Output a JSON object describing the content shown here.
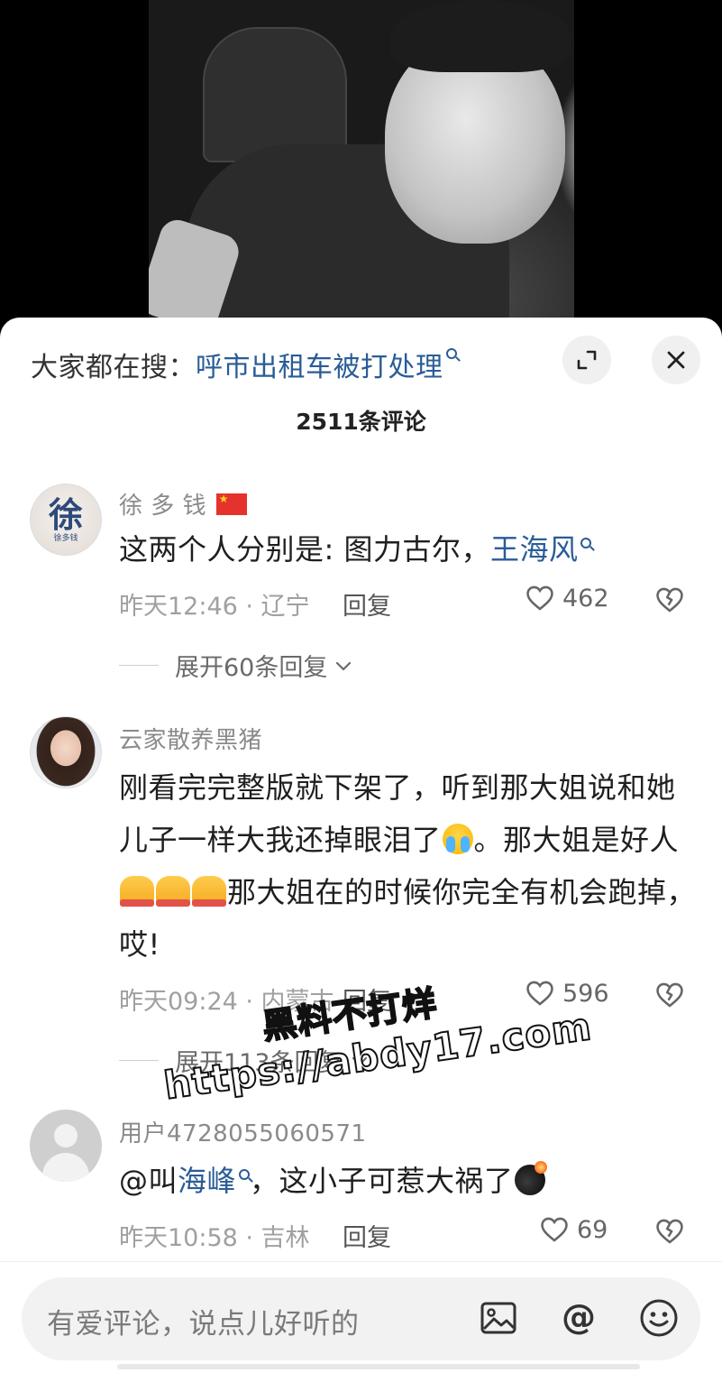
{
  "search": {
    "prefix": "大家都在搜：",
    "term": "呼市出租车被打处理"
  },
  "comments_count": "2511条评论",
  "comments": [
    {
      "username": "徐 多 钱",
      "avatar_text": "徐",
      "avatar_subtext": "徐多钱",
      "text_before_link": "这两个人分别是: 图力古尔，",
      "link": "王海风",
      "time_location": "昨天12:46 · 辽宁",
      "reply": "回复",
      "likes": "462",
      "expand": "展开60条回复"
    },
    {
      "username": "云家散养黑猪",
      "text_part1": "刚看完完整版就下架了，听到那大姐说和她儿子一样大我还掉眼泪了",
      "text_part2": "。那大姐是好人",
      "text_part3": "那大姐在的时候你完全有机会跑掉，哎!",
      "time_location": "昨天09:24 · 内蒙古",
      "reply": "回复",
      "likes": "596",
      "expand": "展开113条回复"
    },
    {
      "username": "用户4728055060571",
      "text_prefix": "@叫",
      "link": "海峰",
      "text_after_link": "，这小子可惹大祸了",
      "time_location": "昨天10:58 · 吉林",
      "reply": "回复",
      "likes": "69"
    }
  ],
  "watermark": {
    "line1": "黑料不打烊",
    "line2": "https://abdy17.com"
  },
  "input": {
    "placeholder": "有爱评论，说点儿好听的"
  },
  "colors": {
    "link": "#2a5c96",
    "sheet_bg": "#ffffff",
    "input_bg": "#f2f2f2"
  }
}
